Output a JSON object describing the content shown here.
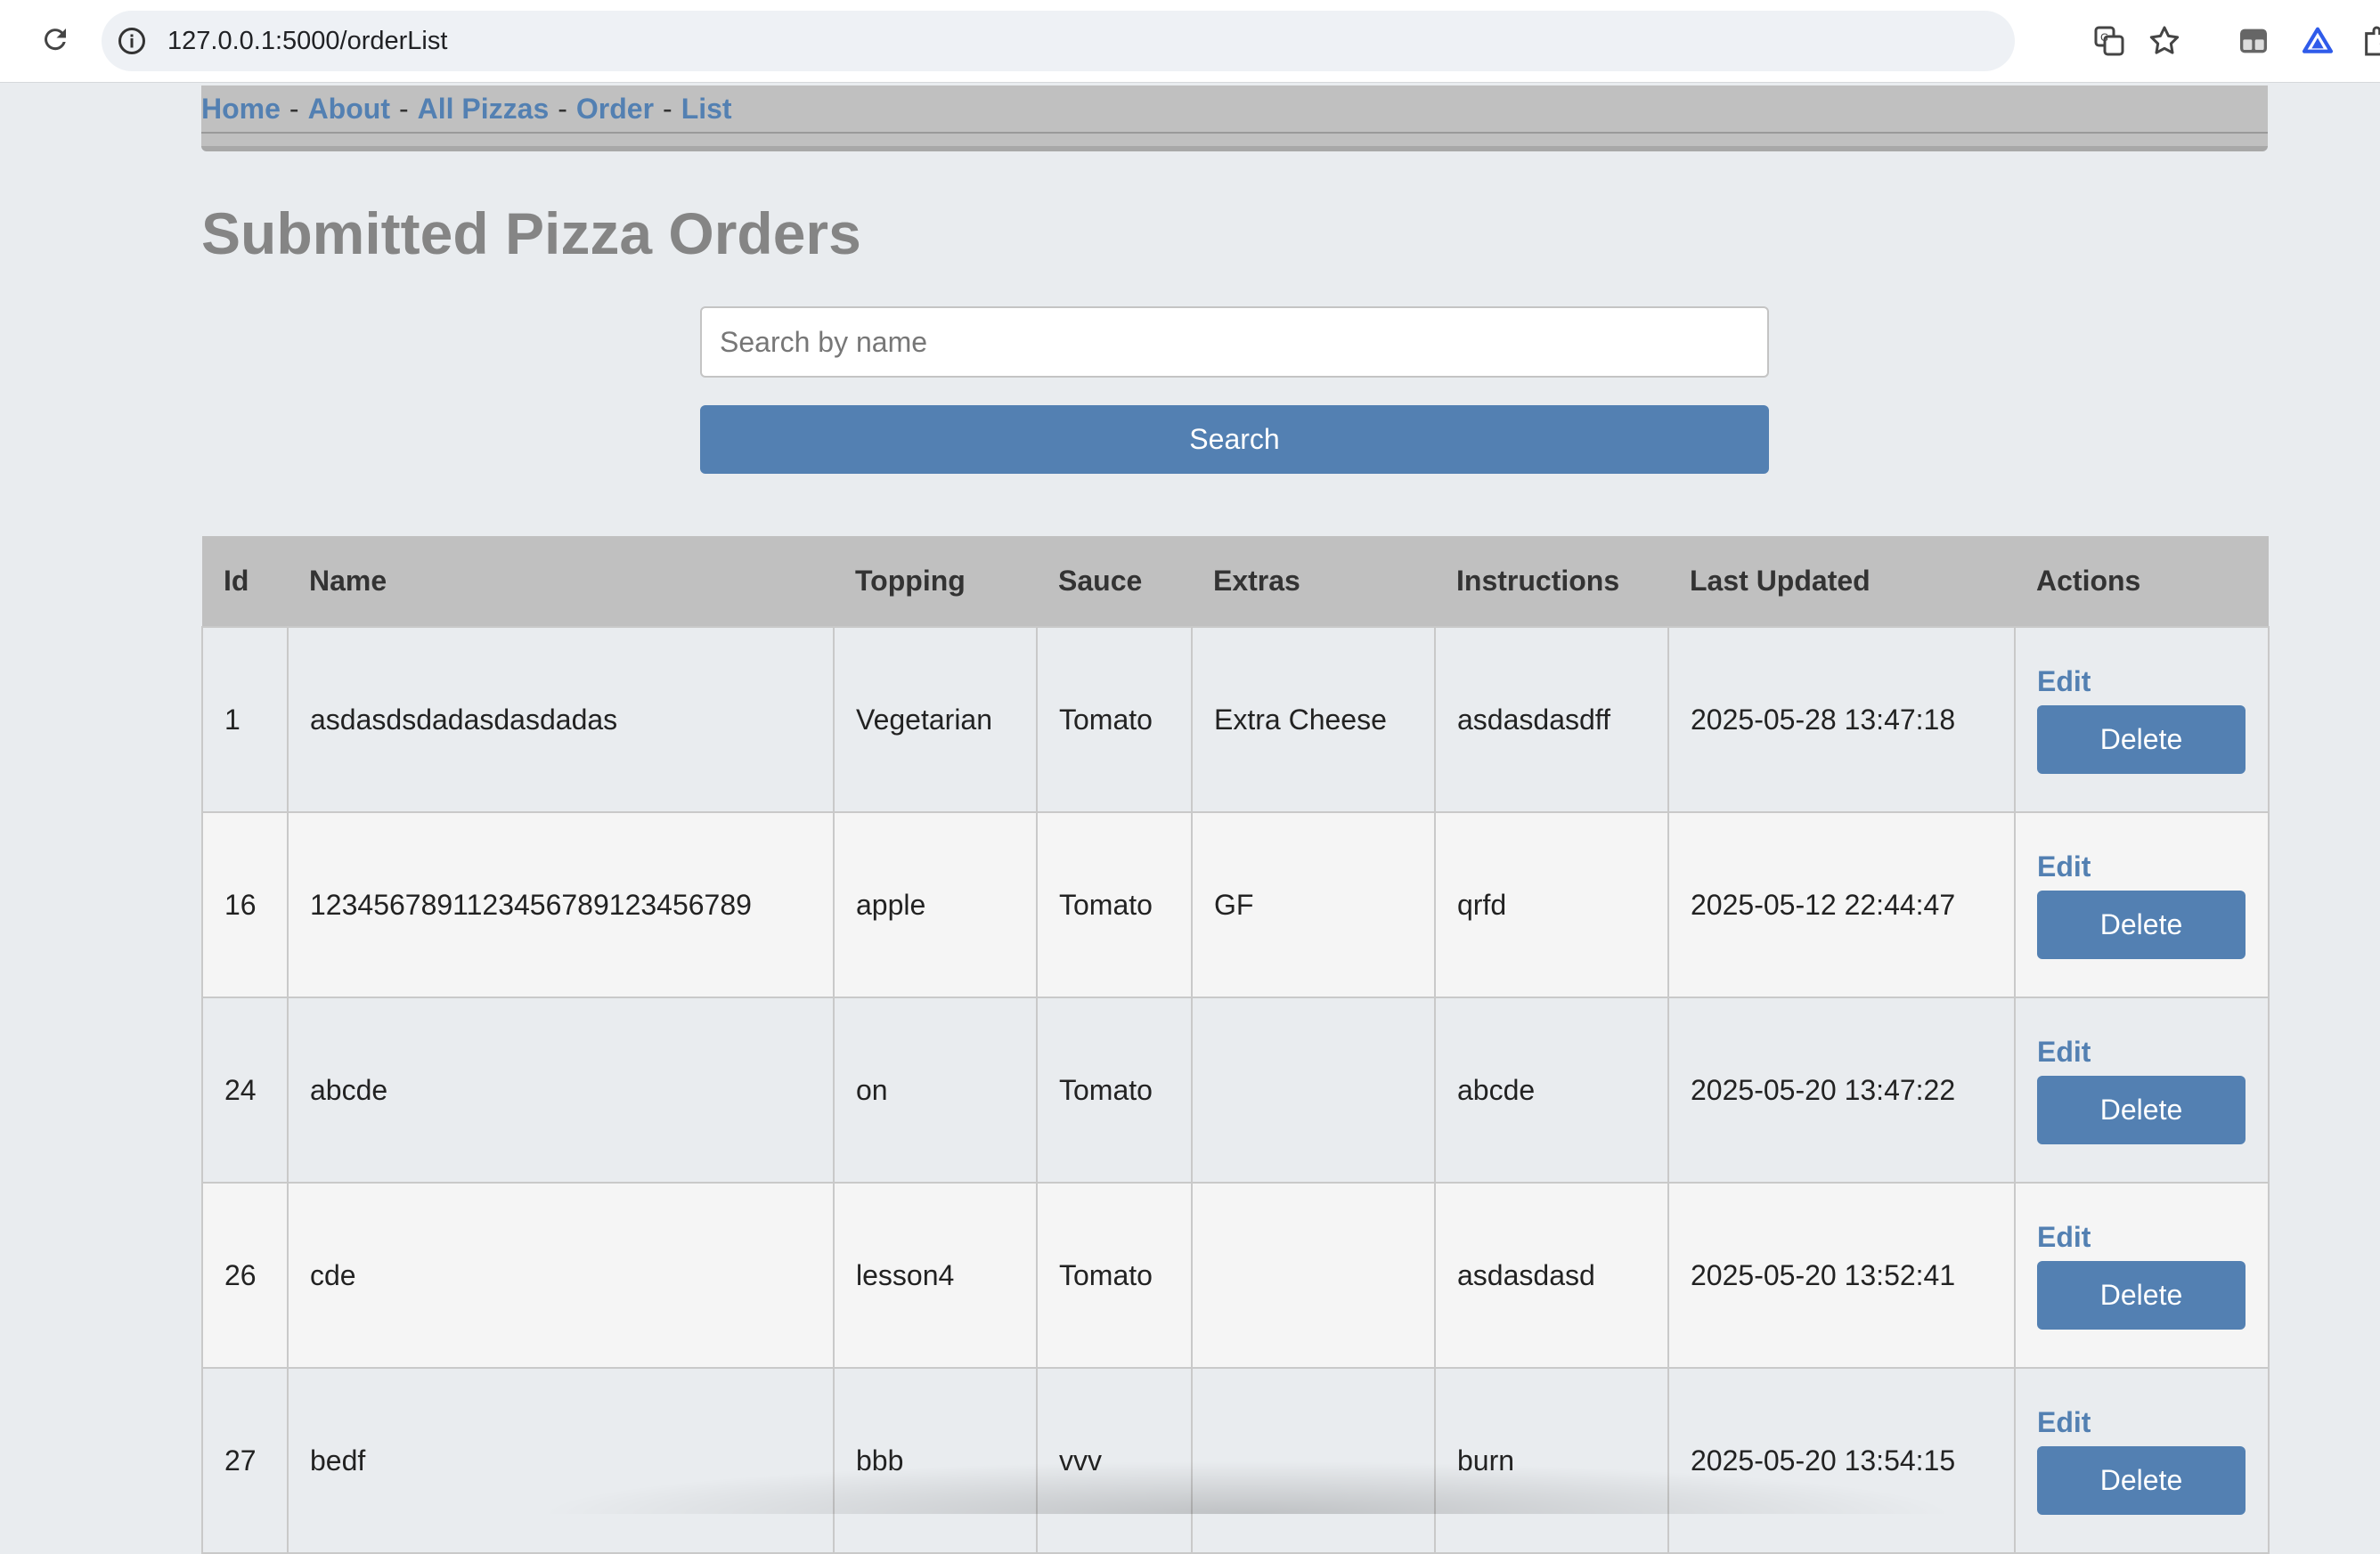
{
  "browser": {
    "url": "127.0.0.1:5000/orderList",
    "icons": [
      "reload-icon",
      "site-info-icon",
      "translate-icon",
      "bookmark-star-icon",
      "extension-icon",
      "extension-triangle-icon",
      "extensions-puzzle-icon"
    ]
  },
  "nav": {
    "links": [
      "Home",
      "About",
      "All Pizzas",
      "Order",
      "List"
    ],
    "separator": "-"
  },
  "page": {
    "title": "Submitted Pizza Orders"
  },
  "search": {
    "placeholder": "Search by name",
    "value": "",
    "button_label": "Search"
  },
  "table": {
    "columns": [
      "Id",
      "Name",
      "Topping",
      "Sauce",
      "Extras",
      "Instructions",
      "Last Updated",
      "Actions"
    ],
    "rows": [
      {
        "id": "1",
        "name": "asdasdsdadasdasdadas",
        "topping": "Vegetarian",
        "sauce": "Tomato",
        "extras": "Extra Cheese",
        "instructions": "asdasdasdff",
        "updated": "2025-05-28 13:47:18"
      },
      {
        "id": "16",
        "name": "123456789112345678912345678​9",
        "topping": "apple",
        "sauce": "Tomato",
        "extras": "GF",
        "instructions": "qrfd",
        "updated": "2025-05-12 22:44:47"
      },
      {
        "id": "24",
        "name": "abcde",
        "topping": "on",
        "sauce": "Tomato",
        "extras": "",
        "instructions": "abcde",
        "updated": "2025-05-20 13:47:22"
      },
      {
        "id": "26",
        "name": "cde",
        "topping": "lesson4",
        "sauce": "Tomato",
        "extras": "",
        "instructions": "asdasdasd",
        "updated": "2025-05-20 13:52:41"
      },
      {
        "id": "27",
        "name": "bedf",
        "topping": "bbb",
        "sauce": "vvv",
        "extras": "",
        "instructions": "burn",
        "updated": "2025-05-20 13:54:15"
      }
    ],
    "edit_label": "Edit",
    "delete_label": "Delete"
  },
  "colors": {
    "accent": "#5380b2",
    "navbar": "#c0c0c0",
    "background": "#e9ecef",
    "title": "#858585"
  }
}
